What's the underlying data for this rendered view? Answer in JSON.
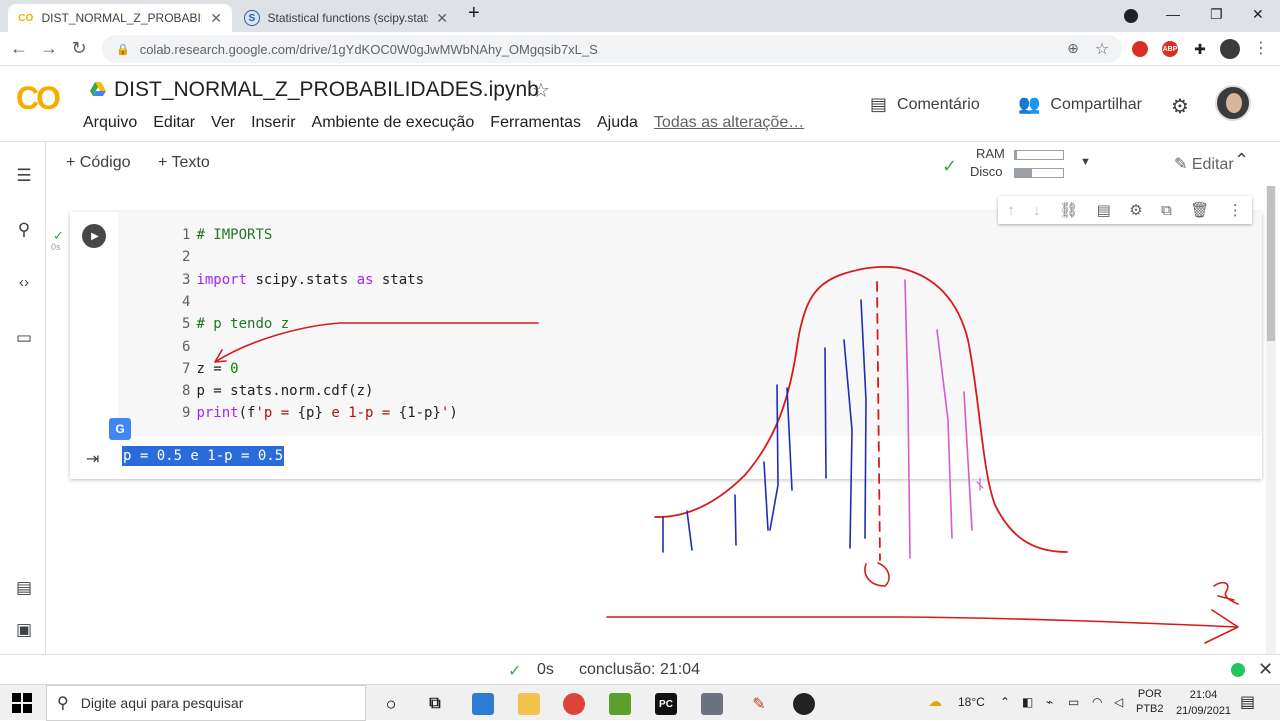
{
  "browser": {
    "tabs": [
      {
        "title": "DIST_NORMAL_Z_PROBABILIDADE",
        "favicon": "CO"
      },
      {
        "title": "Statistical functions (scipy.stats) -",
        "favicon": "S"
      }
    ],
    "url": "colab.research.google.com/drive/1gYdKOC0W0gJwMWbNAhy_OMgqsib7xL_S"
  },
  "colab": {
    "logo": "CO",
    "notebook_title": "DIST_NORMAL_Z_PROBABILIDADES.ipynb",
    "menu": [
      "Arquivo",
      "Editar",
      "Ver",
      "Inserir",
      "Ambiente de execução",
      "Ferramentas",
      "Ajuda"
    ],
    "saved_status": "Todas as alteraçõe…",
    "comment_label": "Comentário",
    "share_label": "Compartilhar"
  },
  "toolbar": {
    "add_code": "+ Código",
    "add_text": "+ Texto",
    "ram_label": "RAM",
    "disk_label": "Disco",
    "ram_usage": 0.05,
    "disk_usage": 0.35,
    "edit_label": "Editar"
  },
  "cell": {
    "exec_time": "0s",
    "lines": [
      {
        "n": "1",
        "parts": [
          {
            "t": "# IMPORTS",
            "c": "c-com"
          }
        ]
      },
      {
        "n": "2",
        "parts": []
      },
      {
        "n": "3",
        "parts": [
          {
            "t": "import",
            "c": "c-kw"
          },
          {
            "t": " scipy.stats ",
            "c": ""
          },
          {
            "t": "as",
            "c": "c-kw"
          },
          {
            "t": " stats",
            "c": ""
          }
        ]
      },
      {
        "n": "4",
        "parts": []
      },
      {
        "n": "5",
        "parts": [
          {
            "t": "# p tendo z",
            "c": "c-com"
          }
        ]
      },
      {
        "n": "6",
        "parts": []
      },
      {
        "n": "7",
        "parts": [
          {
            "t": "z = ",
            "c": ""
          },
          {
            "t": "0",
            "c": "c-num"
          }
        ]
      },
      {
        "n": "8",
        "parts": [
          {
            "t": "p = stats.norm.cdf(z)",
            "c": ""
          }
        ]
      },
      {
        "n": "9",
        "parts": [
          {
            "t": "print",
            "c": "c-kw"
          },
          {
            "t": "(f",
            "c": ""
          },
          {
            "t": "'p = ",
            "c": "c-str"
          },
          {
            "t": "{p}",
            "c": ""
          },
          {
            "t": " e 1-p = ",
            "c": "c-str"
          },
          {
            "t": "{1-p}",
            "c": ""
          },
          {
            "t": "'",
            "c": "c-str"
          },
          {
            "t": ")",
            "c": ""
          }
        ]
      }
    ],
    "output": "p = 0.5 e 1-p = 0.5"
  },
  "status": {
    "exec_time": "0s",
    "completion": "conclusão: 21:04"
  },
  "taskbar": {
    "search_placeholder": "Digite aqui para pesquisar",
    "temperature": "18°C",
    "lang": "POR",
    "lang_sub": "PTB2",
    "time": "21:04",
    "date": "21/09/2021"
  },
  "drawing": {
    "z_label": "z",
    "zero_label": "0"
  },
  "colors": {
    "accent_orange": "#f9ab00",
    "selection": "#2a6cd9",
    "pen_red": "#d91a1a",
    "pen_blue": "#1a2fb5",
    "pen_pink": "#d65ad6"
  }
}
